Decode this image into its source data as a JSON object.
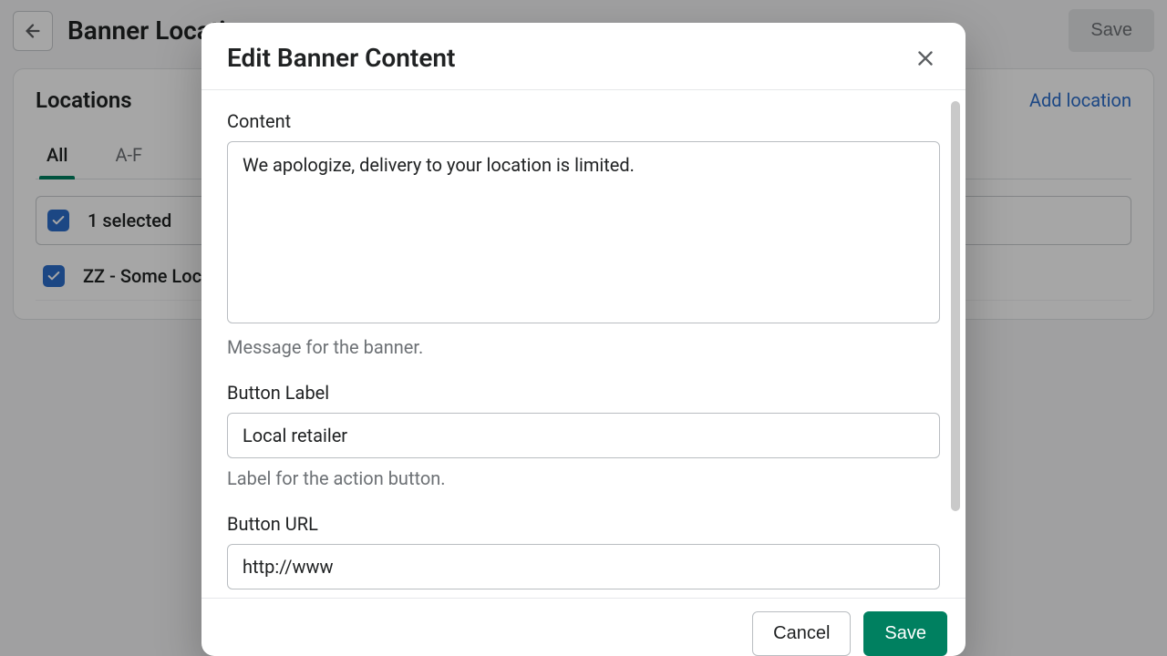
{
  "header": {
    "title": "Banner Locations",
    "save_label": "Save"
  },
  "card": {
    "title": "Locations",
    "add_link": "Add location",
    "tabs": {
      "all": "All",
      "range": "A-F"
    },
    "selected_text": "1 selected",
    "row_label": "ZZ - Some Location"
  },
  "modal": {
    "title": "Edit Banner Content",
    "content": {
      "label": "Content",
      "value": "We apologize, delivery to your location is limited.",
      "help": "Message for the banner."
    },
    "button_label": {
      "label": "Button Label",
      "value": "Local retailer",
      "help": "Label for the action button."
    },
    "button_url": {
      "label": "Button URL",
      "value": "http://www"
    },
    "footer": {
      "cancel": "Cancel",
      "save": "Save"
    }
  }
}
